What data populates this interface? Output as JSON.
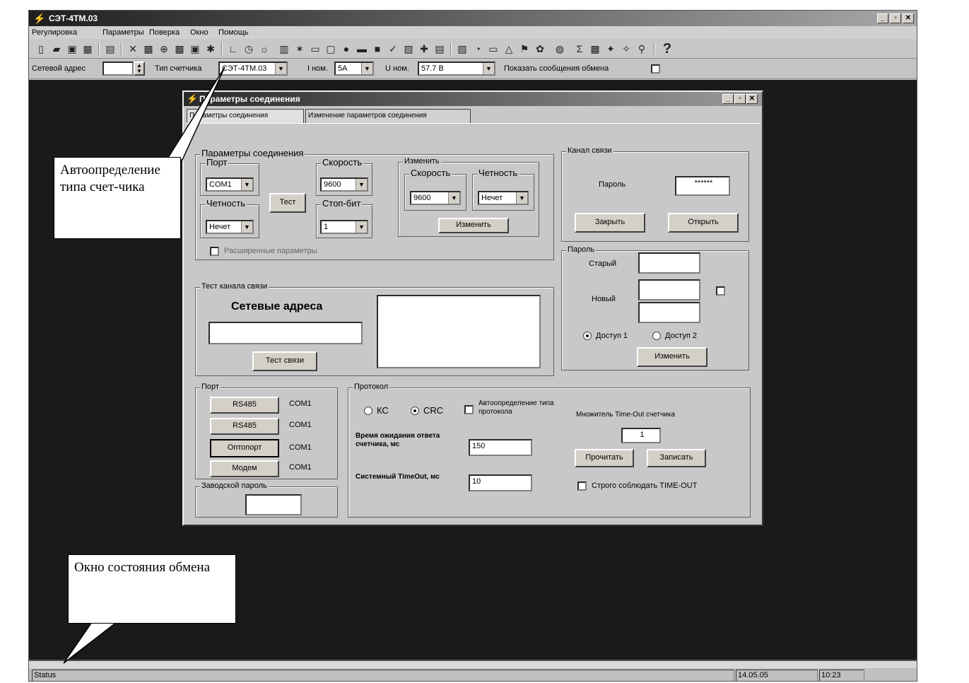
{
  "app": {
    "title": "СЭТ-4ТМ.03"
  },
  "menu": [
    "Регулировка",
    "Параметры",
    "Поверка",
    "Окно",
    "Помощь"
  ],
  "toolbar_icons": [
    "new-file-icon",
    "open-folder-icon",
    "save-icon",
    "save-all-icon",
    "print-icon",
    "tool-1-icon",
    "tool-2-icon",
    "tool-3-icon",
    "tool-4-icon",
    "tool-5-icon",
    "tool-6-icon",
    "graph-icon",
    "clock-icon",
    "sun-icon",
    "bar-chart-icon",
    "wand-icon",
    "monitor-icon",
    "rectangle-icon",
    "info-icon",
    "tool-7-icon",
    "tool-8-icon",
    "check-icon",
    "tool-9-icon",
    "tool-10-icon",
    "tool-11-icon",
    "tool-12-icon",
    "tool-13-icon",
    "tool-14-icon",
    "triangle-icon",
    "flag-icon",
    "tool-15-icon",
    "tool-16-icon",
    "sigma-icon",
    "tool-17-icon",
    "tool-18-icon",
    "tool-19-icon",
    "tool-20-icon",
    "help-icon"
  ],
  "params_bar": {
    "net_address_label": "Сетевой адрес",
    "net_address_value": "",
    "meter_type_label": "Тип счетчика",
    "meter_type_value": "СЭТ-4ТМ.03",
    "inom_label": "I ном.",
    "inom_value": "5A",
    "unom_label": "U ном.",
    "unom_value": "57.7 В",
    "show_exchange_label": "Показать сообщения обмена"
  },
  "dialog": {
    "title": "Параметры соединения",
    "tabs": [
      "Параметры соединения",
      "Изменение параметров соединения"
    ],
    "conn_group": {
      "title": "Параметры соединения",
      "port_label": "Порт",
      "port_value": "COM1",
      "parity_label": "Четность",
      "parity_value": "Нечет",
      "speed_label": "Скорость",
      "speed_value": "9600",
      "stopbit_label": "Стоп-бит",
      "stopbit_value": "1",
      "test_button": "Тест",
      "extended_label": "Расширенные параметры"
    },
    "change_group": {
      "title": "Изменить",
      "speed_label": "Скорость",
      "speed_value": "9600",
      "parity_label": "Четность",
      "parity_value": "Нечет",
      "change_button": "Изменить"
    },
    "channel_group": {
      "title": "Канал связи",
      "password_label": "Пароль",
      "password_value": "******",
      "close_button": "Закрыть",
      "open_button": "Открыть"
    },
    "password_group": {
      "title": "Пароль",
      "old_label": "Старый",
      "new_label": "Новый",
      "access1": "Доступ 1",
      "access2": "Доступ 2",
      "change_button": "Изменить"
    },
    "test_group": {
      "title": "Тест канала связи",
      "net_addresses": "Сетевые адреса",
      "test_button": "Тест связи"
    },
    "port_group": {
      "title": "Порт",
      "rows": [
        {
          "button": "RS485",
          "com": "COM1"
        },
        {
          "button": "RS485",
          "com": "COM1"
        },
        {
          "button": "Оптопорт",
          "com": "COM1"
        },
        {
          "button": "Модем",
          "com": "COM1"
        }
      ]
    },
    "factory_group": {
      "title": "Заводской пароль"
    },
    "protocol_group": {
      "title": "Протокол",
      "kc": "КС",
      "crc": "CRC",
      "auto_protocol": "Автоопределение типа протокола",
      "wait_label": "Время ожидания ответа счетчика, мс",
      "wait_value": "150",
      "system_label": "Системный TimeOut, мс",
      "system_value": "10",
      "multiplier_label": "Множитель Time-Out счетчика",
      "multiplier_value": "1",
      "read_button": "Прочитать",
      "write_button": "Записать",
      "strict_label": "Строго соблюдать TIME-OUT"
    }
  },
  "callouts": {
    "autodetect": "Автоопределение типа счет-чика",
    "status_window": "Окно состояния обмена"
  },
  "statusbar": {
    "status": "Status",
    "date": "14.05.05",
    "time": "10:23"
  }
}
